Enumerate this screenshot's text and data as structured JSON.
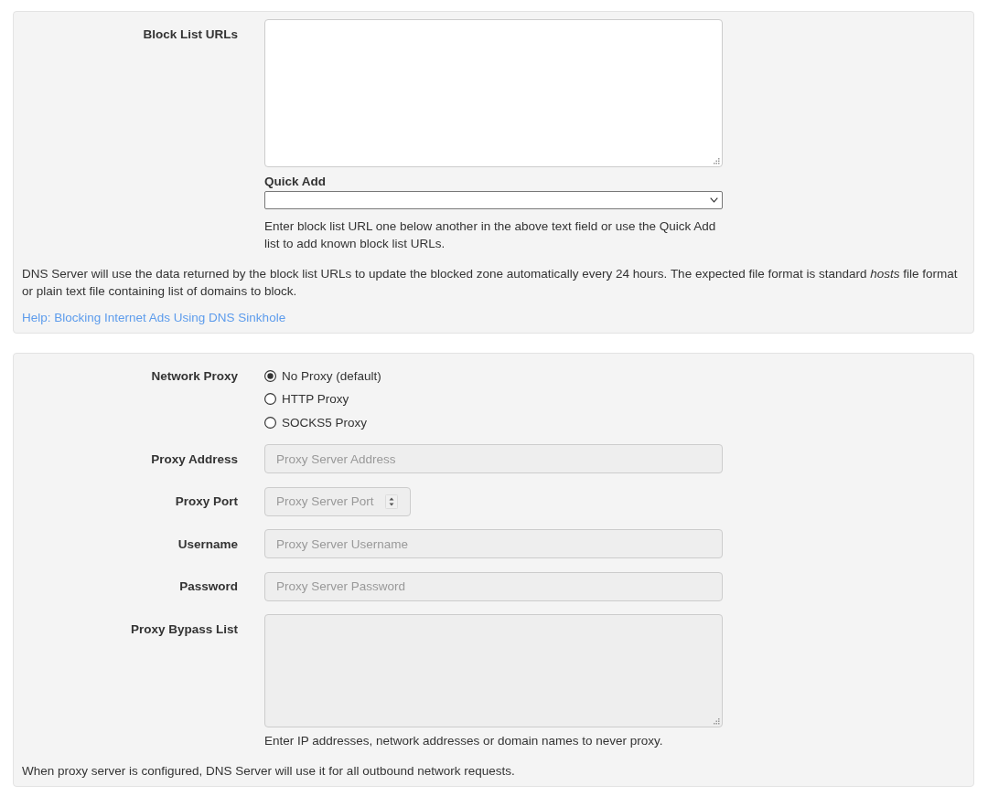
{
  "block_list": {
    "label": "Block List URLs",
    "quick_add": {
      "label": "Quick Add"
    },
    "help": "Enter block list URL one below another in the above text field or use the Quick Add list to add known block list URLs.",
    "description": "DNS Server will use the data returned by the block list URLs to update the blocked zone automatically every 24 hours. The expected file format is standard *hosts* file format or plain text file containing list of domains to block.",
    "help_link": "Help: Blocking Internet Ads Using DNS Sinkhole"
  },
  "proxy": {
    "network_proxy": {
      "label": "Network Proxy",
      "options": [
        {
          "label": "No Proxy (default)",
          "selected": true
        },
        {
          "label": "HTTP Proxy",
          "selected": false
        },
        {
          "label": "SOCKS5 Proxy",
          "selected": false
        }
      ]
    },
    "fields": [
      {
        "label": "Proxy Address",
        "placeholder": "Proxy Server Address",
        "kind": "text",
        "disabled": true
      },
      {
        "label": "Proxy Port",
        "placeholder": "Proxy Server Port",
        "kind": "number",
        "disabled": true
      },
      {
        "label": "Username",
        "placeholder": "Proxy Server Username",
        "kind": "text",
        "disabled": true
      },
      {
        "label": "Password",
        "placeholder": "Proxy Server Password",
        "kind": "password",
        "disabled": true
      }
    ],
    "bypass_list": {
      "label": "Proxy Bypass List",
      "disabled": true,
      "help": "Enter IP addresses, network addresses or domain names to never proxy."
    },
    "note": "When proxy server is configured, DNS Server will use it for all outbound network requests."
  }
}
